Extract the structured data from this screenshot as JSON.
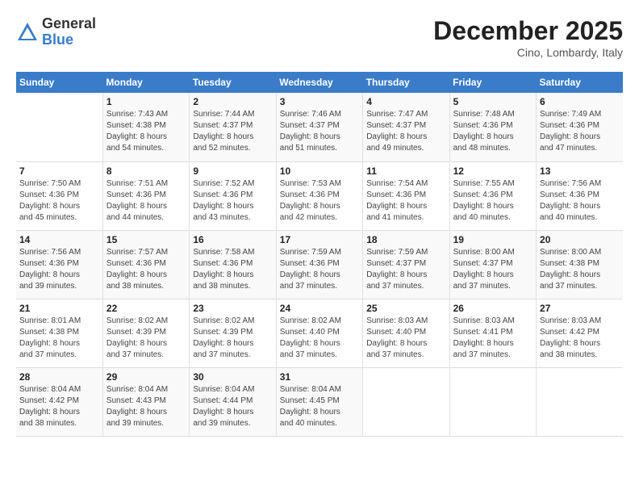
{
  "logo": {
    "general": "General",
    "blue": "Blue"
  },
  "header": {
    "month": "December 2025",
    "location": "Cino, Lombardy, Italy"
  },
  "weekdays": [
    "Sunday",
    "Monday",
    "Tuesday",
    "Wednesday",
    "Thursday",
    "Friday",
    "Saturday"
  ],
  "weeks": [
    [
      {
        "day": "",
        "info": ""
      },
      {
        "day": "1",
        "info": "Sunrise: 7:43 AM\nSunset: 4:38 PM\nDaylight: 8 hours\nand 54 minutes."
      },
      {
        "day": "2",
        "info": "Sunrise: 7:44 AM\nSunset: 4:37 PM\nDaylight: 8 hours\nand 52 minutes."
      },
      {
        "day": "3",
        "info": "Sunrise: 7:46 AM\nSunset: 4:37 PM\nDaylight: 8 hours\nand 51 minutes."
      },
      {
        "day": "4",
        "info": "Sunrise: 7:47 AM\nSunset: 4:37 PM\nDaylight: 8 hours\nand 49 minutes."
      },
      {
        "day": "5",
        "info": "Sunrise: 7:48 AM\nSunset: 4:36 PM\nDaylight: 8 hours\nand 48 minutes."
      },
      {
        "day": "6",
        "info": "Sunrise: 7:49 AM\nSunset: 4:36 PM\nDaylight: 8 hours\nand 47 minutes."
      }
    ],
    [
      {
        "day": "7",
        "info": "Sunrise: 7:50 AM\nSunset: 4:36 PM\nDaylight: 8 hours\nand 45 minutes."
      },
      {
        "day": "8",
        "info": "Sunrise: 7:51 AM\nSunset: 4:36 PM\nDaylight: 8 hours\nand 44 minutes."
      },
      {
        "day": "9",
        "info": "Sunrise: 7:52 AM\nSunset: 4:36 PM\nDaylight: 8 hours\nand 43 minutes."
      },
      {
        "day": "10",
        "info": "Sunrise: 7:53 AM\nSunset: 4:36 PM\nDaylight: 8 hours\nand 42 minutes."
      },
      {
        "day": "11",
        "info": "Sunrise: 7:54 AM\nSunset: 4:36 PM\nDaylight: 8 hours\nand 41 minutes."
      },
      {
        "day": "12",
        "info": "Sunrise: 7:55 AM\nSunset: 4:36 PM\nDaylight: 8 hours\nand 40 minutes."
      },
      {
        "day": "13",
        "info": "Sunrise: 7:56 AM\nSunset: 4:36 PM\nDaylight: 8 hours\nand 40 minutes."
      }
    ],
    [
      {
        "day": "14",
        "info": "Sunrise: 7:56 AM\nSunset: 4:36 PM\nDaylight: 8 hours\nand 39 minutes."
      },
      {
        "day": "15",
        "info": "Sunrise: 7:57 AM\nSunset: 4:36 PM\nDaylight: 8 hours\nand 38 minutes."
      },
      {
        "day": "16",
        "info": "Sunrise: 7:58 AM\nSunset: 4:36 PM\nDaylight: 8 hours\nand 38 minutes."
      },
      {
        "day": "17",
        "info": "Sunrise: 7:59 AM\nSunset: 4:36 PM\nDaylight: 8 hours\nand 37 minutes."
      },
      {
        "day": "18",
        "info": "Sunrise: 7:59 AM\nSunset: 4:37 PM\nDaylight: 8 hours\nand 37 minutes."
      },
      {
        "day": "19",
        "info": "Sunrise: 8:00 AM\nSunset: 4:37 PM\nDaylight: 8 hours\nand 37 minutes."
      },
      {
        "day": "20",
        "info": "Sunrise: 8:00 AM\nSunset: 4:38 PM\nDaylight: 8 hours\nand 37 minutes."
      }
    ],
    [
      {
        "day": "21",
        "info": "Sunrise: 8:01 AM\nSunset: 4:38 PM\nDaylight: 8 hours\nand 37 minutes."
      },
      {
        "day": "22",
        "info": "Sunrise: 8:02 AM\nSunset: 4:39 PM\nDaylight: 8 hours\nand 37 minutes."
      },
      {
        "day": "23",
        "info": "Sunrise: 8:02 AM\nSunset: 4:39 PM\nDaylight: 8 hours\nand 37 minutes."
      },
      {
        "day": "24",
        "info": "Sunrise: 8:02 AM\nSunset: 4:40 PM\nDaylight: 8 hours\nand 37 minutes."
      },
      {
        "day": "25",
        "info": "Sunrise: 8:03 AM\nSunset: 4:40 PM\nDaylight: 8 hours\nand 37 minutes."
      },
      {
        "day": "26",
        "info": "Sunrise: 8:03 AM\nSunset: 4:41 PM\nDaylight: 8 hours\nand 37 minutes."
      },
      {
        "day": "27",
        "info": "Sunrise: 8:03 AM\nSunset: 4:42 PM\nDaylight: 8 hours\nand 38 minutes."
      }
    ],
    [
      {
        "day": "28",
        "info": "Sunrise: 8:04 AM\nSunset: 4:42 PM\nDaylight: 8 hours\nand 38 minutes."
      },
      {
        "day": "29",
        "info": "Sunrise: 8:04 AM\nSunset: 4:43 PM\nDaylight: 8 hours\nand 39 minutes."
      },
      {
        "day": "30",
        "info": "Sunrise: 8:04 AM\nSunset: 4:44 PM\nDaylight: 8 hours\nand 39 minutes."
      },
      {
        "day": "31",
        "info": "Sunrise: 8:04 AM\nSunset: 4:45 PM\nDaylight: 8 hours\nand 40 minutes."
      },
      {
        "day": "",
        "info": ""
      },
      {
        "day": "",
        "info": ""
      },
      {
        "day": "",
        "info": ""
      }
    ]
  ]
}
